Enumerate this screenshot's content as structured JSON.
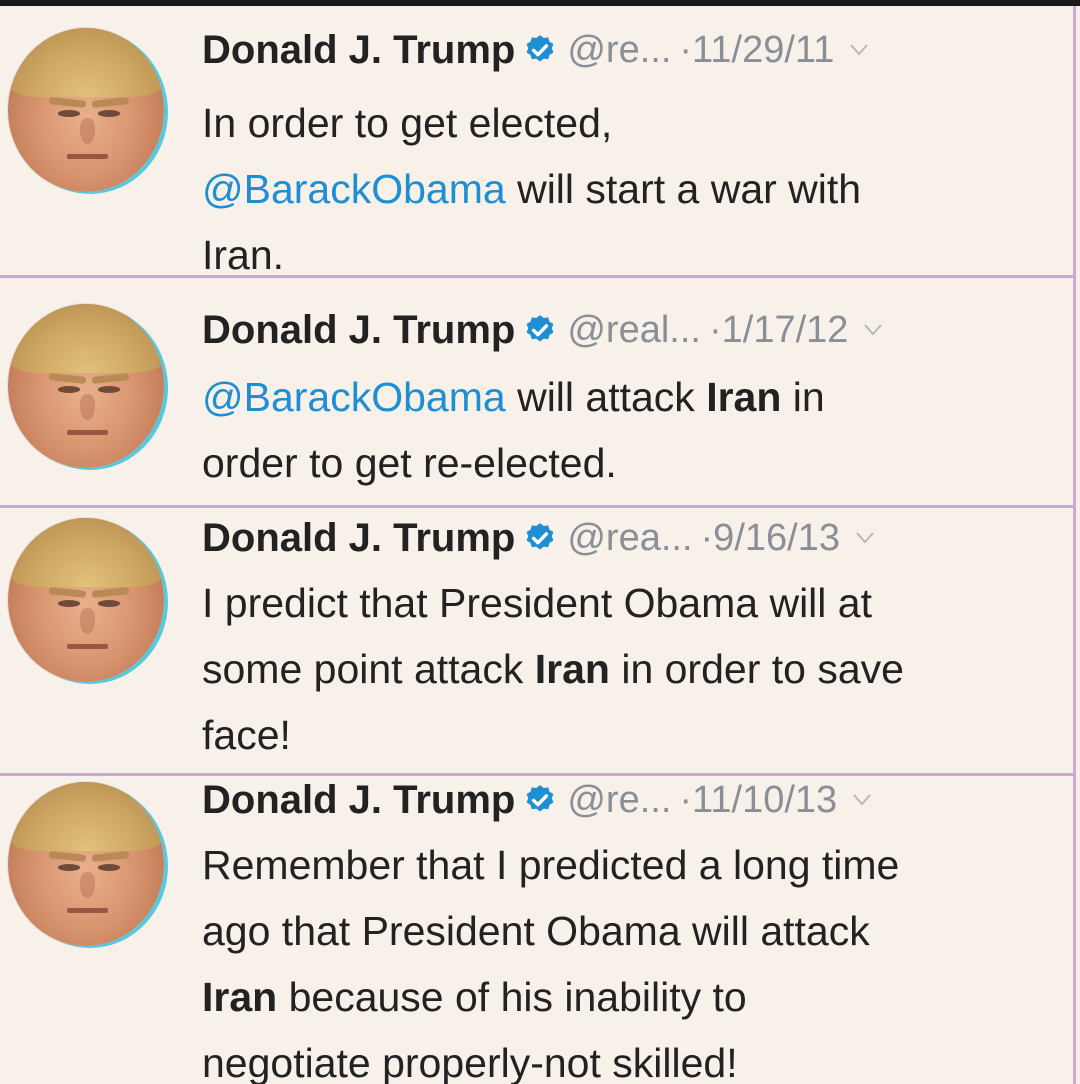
{
  "tweets": [
    {
      "name": "Donald J. Trump",
      "handle": "@re...",
      "date": "·11/29/11",
      "body": {
        "line1": "In order to get elected,",
        "mention": "@BarackObama",
        "line2_rest": " will start a war with",
        "line3": "Iran."
      }
    },
    {
      "name": "Donald J. Trump",
      "handle": "@real...",
      "date": "·1/17/12",
      "body": {
        "mention": "@BarackObama",
        "text1": " will attack ",
        "bold1": "Iran",
        "text2": " in",
        "line2": "order to get re-elected."
      }
    },
    {
      "name": "Donald J. Trump",
      "handle": "@rea...",
      "date": "·9/16/13",
      "body": {
        "line1": "I predict that President Obama will at",
        "text1": "some point attack ",
        "bold1": "Iran",
        "text2": " in order to save",
        "line3": "face!"
      }
    },
    {
      "name": "Donald J. Trump",
      "handle": "@re...",
      "date": "·11/10/13",
      "body": {
        "line1": "Remember that I predicted a long time",
        "line2": "ago that President Obama will attack",
        "bold1": "Iran",
        "text1": " because of his inability to",
        "line4": "negotiate properly-not skilled!"
      }
    }
  ],
  "icons": {
    "verified": "verified-badge-icon",
    "caret": "chevron-down-icon",
    "avatar": "profile-avatar"
  },
  "colors": {
    "mention": "#1d8fd2",
    "verified": "#1d8fd2",
    "muted": "#8a8f97",
    "divider": "#c9a9cf",
    "avatar_ring": "#58c9dc"
  }
}
